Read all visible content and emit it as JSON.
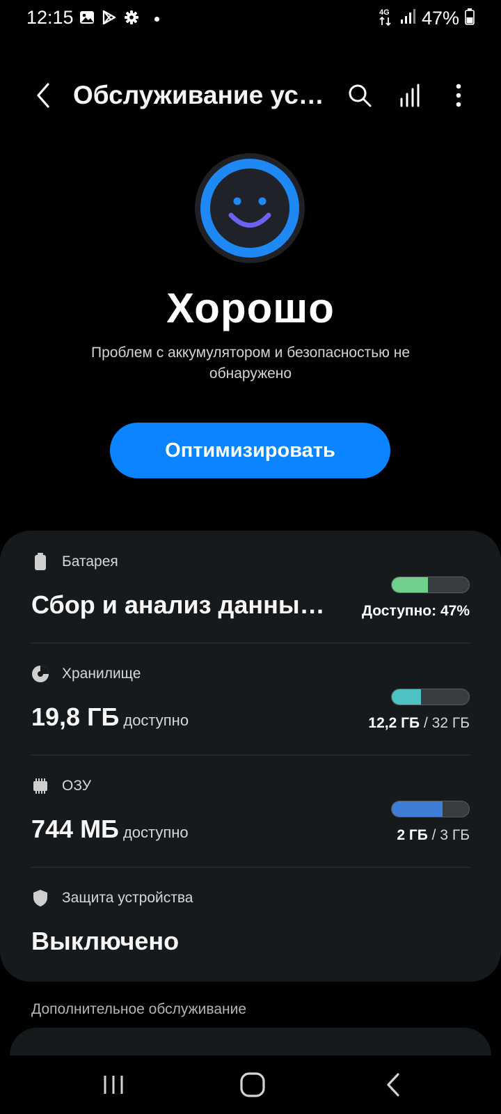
{
  "status_bar": {
    "time": "12:15",
    "network": "4G",
    "battery_percent": "47%"
  },
  "app_bar": {
    "title": "Обслуживание устройства"
  },
  "status": {
    "title": "Хорошо",
    "description": "Проблем с аккумулятором и безопасностью не обнаружено"
  },
  "optimize_button": {
    "label": "Оптимизировать"
  },
  "items": [
    {
      "label": "Батарея",
      "value": "Сбор и анализ данных…",
      "meta_bold": "Доступно: 47%",
      "meta_rest": "",
      "bar_fraction": 0.47,
      "bar_color": "#6fd08c"
    },
    {
      "label": "Хранилище",
      "value": "19,8 ГБ",
      "value_suffix": "доступно",
      "meta_bold": "12,2 ГБ",
      "meta_rest": " / 32 ГБ",
      "bar_fraction": 0.38,
      "bar_color": "#4ec3c6"
    },
    {
      "label": "ОЗУ",
      "value": "744 МБ",
      "value_suffix": "доступно",
      "meta_bold": "2 ГБ",
      "meta_rest": " / 3 ГБ",
      "bar_fraction": 0.66,
      "bar_color": "#3f7ed8"
    },
    {
      "label": "Защита устройства",
      "value": "Выключено"
    }
  ],
  "section_header": "Дополнительное обслуживание",
  "colors": {
    "accent": "#0a84ff",
    "face_ring": "#1e88f5",
    "face_smile": "#6b63f0"
  }
}
